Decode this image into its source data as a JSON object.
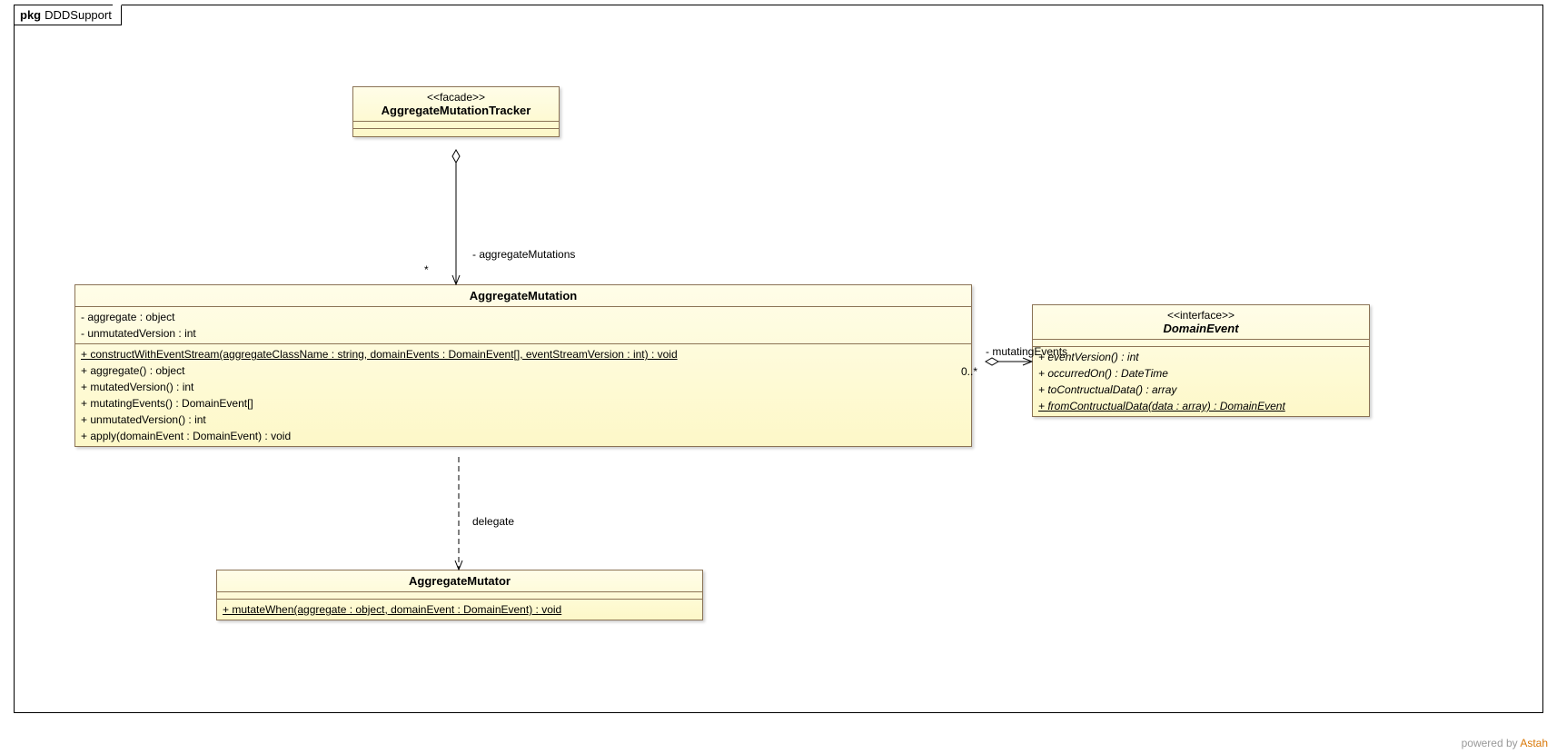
{
  "package": {
    "keyword": "pkg",
    "name": "DDDSupport"
  },
  "classes": {
    "tracker": {
      "stereotype": "<<facade>>",
      "name": "AggregateMutationTracker",
      "attrs": [],
      "ops": []
    },
    "mutation": {
      "name": "AggregateMutation",
      "attrs": [
        "- aggregate : object",
        "- unmutatedVersion : int"
      ],
      "ops": [
        {
          "text": "+ constructWithEventStream(aggregateClassName : string, domainEvents : DomainEvent[], eventStreamVersion : int) : void",
          "static": true
        },
        {
          "text": "+ aggregate() : object"
        },
        {
          "text": "+ mutatedVersion() : int"
        },
        {
          "text": "+ mutatingEvents() : DomainEvent[]"
        },
        {
          "text": "+ unmutatedVersion() : int"
        },
        {
          "text": "+ apply(domainEvent : DomainEvent) : void"
        }
      ]
    },
    "mutator": {
      "name": "AggregateMutator",
      "attrs": [],
      "ops": [
        {
          "text": "+ mutateWhen(aggregate : object, domainEvent : DomainEvent) : void",
          "static": true
        }
      ]
    },
    "domainEvent": {
      "stereotype": "<<interface>>",
      "name": "DomainEvent",
      "attrs": [],
      "ops": [
        {
          "text": "+ eventVersion() : int",
          "abstract": true
        },
        {
          "text": "+ occurredOn() : DateTime",
          "abstract": true
        },
        {
          "text": "+ toContructualData() : array",
          "abstract": true
        },
        {
          "text": "+ fromContructualData(data : array) : DomainEvent",
          "static": true,
          "abstract": true
        }
      ]
    }
  },
  "labels": {
    "aggMutations": "- aggregateMutations",
    "aggMutationsMult": "*",
    "mutatingEvents": "- mutatingEvents",
    "mutatingEventsMult": "0..*",
    "delegate": "delegate"
  },
  "footer": {
    "prefix": "powered by ",
    "name": "Astah"
  }
}
